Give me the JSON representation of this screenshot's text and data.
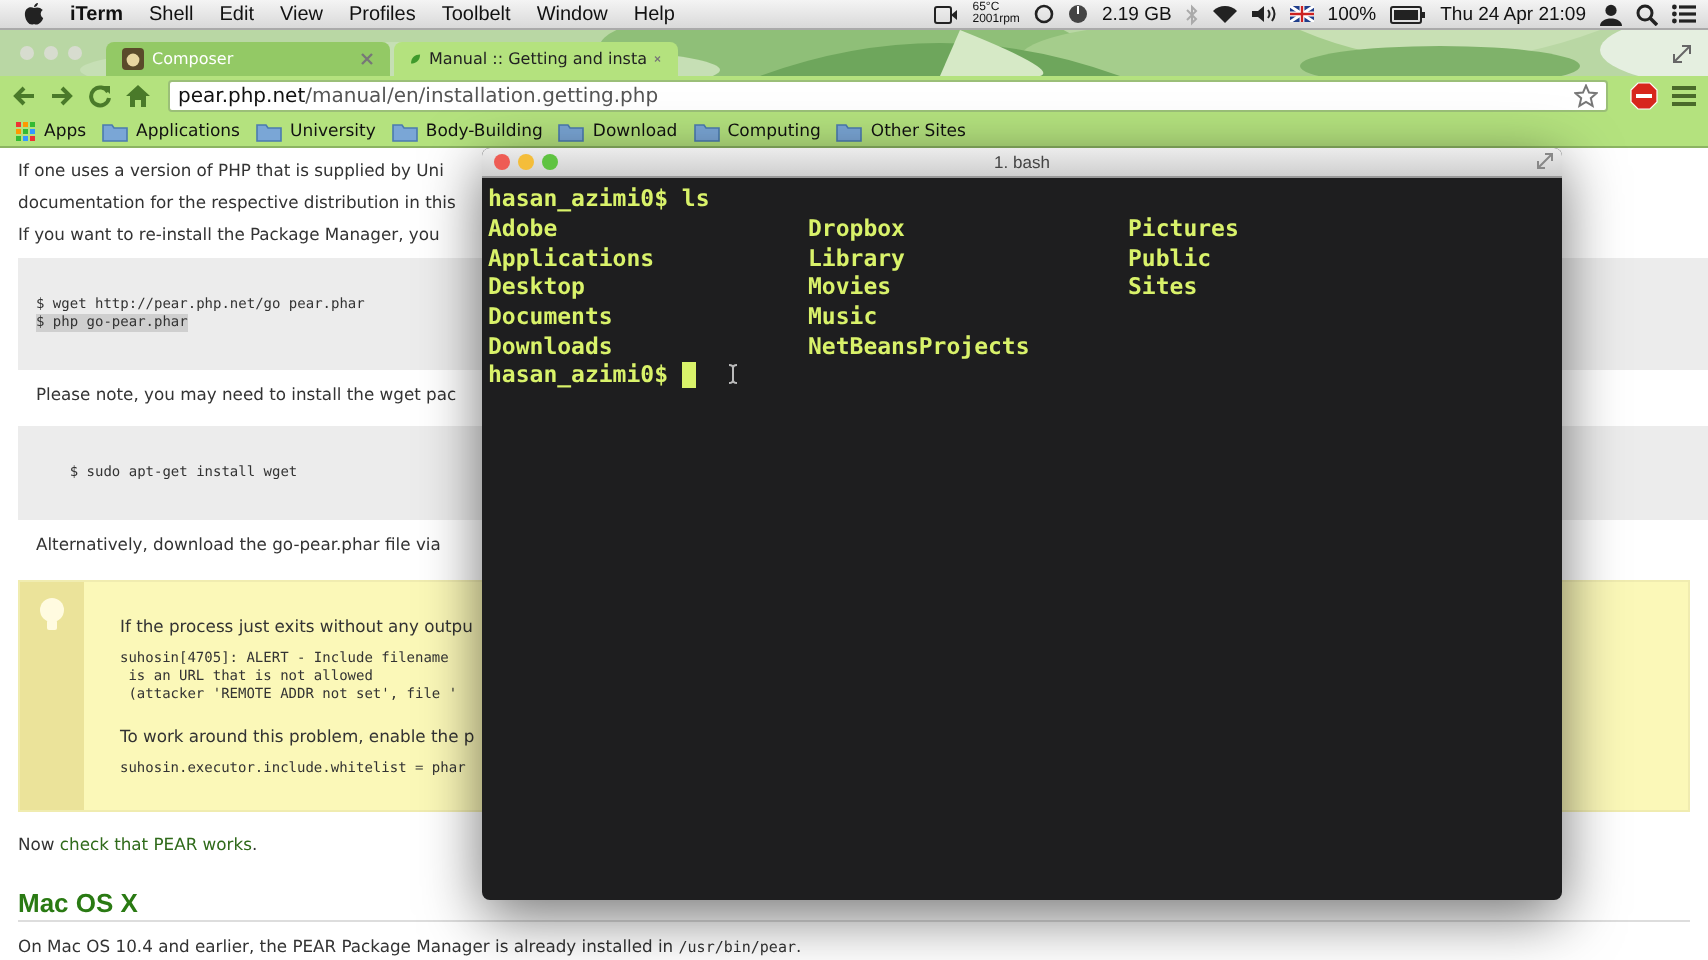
{
  "menubar": {
    "app": "iTerm",
    "menus": [
      "Shell",
      "Edit",
      "View",
      "Profiles",
      "Toolbelt",
      "Window",
      "Help"
    ],
    "status": {
      "temperature": "65°C",
      "fan": "2001rpm",
      "memory": "2.19 GB",
      "battery": "100%",
      "clock": "Thu 24 Apr  21:09"
    }
  },
  "browser": {
    "tabs": [
      {
        "label": "Composer",
        "selected": false
      },
      {
        "label": "Manual :: Getting and insta",
        "selected": true
      }
    ],
    "url": {
      "host": "pear.php.net",
      "path": "/manual/en/installation.getting.php"
    },
    "bookmarks": [
      {
        "label": "Apps",
        "kind": "apps"
      },
      {
        "label": "Applications",
        "kind": "folder"
      },
      {
        "label": "University",
        "kind": "folder"
      },
      {
        "label": "Body-Building",
        "kind": "folder"
      },
      {
        "label": "Download",
        "kind": "folder"
      },
      {
        "label": "Computing",
        "kind": "folder"
      },
      {
        "label": "Other Sites",
        "kind": "folder"
      }
    ]
  },
  "page": {
    "blocks": [
      {
        "kind": "para",
        "lines": [
          "If one uses a version of PHP that is supplied by Uni",
          "documentation for the respective distribution in this"
        ]
      },
      {
        "kind": "para",
        "lines": [
          "If you want to re-install the Package Manager, you"
        ]
      },
      {
        "kind": "code",
        "lines": [
          {
            "text": "$ wget http://pear.php.net/go pear.phar",
            "highlighted": false
          },
          {
            "text": "$ php go-pear.phar",
            "highlighted": true
          }
        ]
      },
      {
        "kind": "indent",
        "lines": [
          "Please note, you may need to install the wget pac"
        ]
      },
      {
        "kind": "code",
        "lines": [
          {
            "text": "    $ sudo apt-get install wget",
            "highlighted": false
          }
        ]
      },
      {
        "kind": "indent",
        "lines": [
          "Alternatively, download the go-pear.phar file via"
        ]
      },
      {
        "kind": "note",
        "blocks": [
          {
            "kind": "para",
            "lines": [
              "If the process just exits without any outpu"
            ]
          },
          {
            "kind": "code",
            "lines": [
              {
                "text": "suhosin[4705]: ALERT - Include filename",
                "highlighted": false
              },
              {
                "text": " is an URL that is not allowed",
                "highlighted": false
              },
              {
                "text": " (attacker 'REMOTE ADDR not set', file '",
                "highlighted": false
              }
            ]
          },
          {
            "kind": "para",
            "lines": [
              "To work around this problem, enable the p"
            ]
          },
          {
            "kind": "code",
            "lines": [
              {
                "text": "suhosin.executor.include.whitelist = phar",
                "highlighted": false
              }
            ]
          }
        ]
      },
      {
        "kind": "mixed",
        "parts": [
          {
            "text": "Now "
          },
          {
            "text": "check that PEAR works",
            "link": true
          },
          {
            "text": "."
          }
        ]
      },
      {
        "kind": "heading",
        "lines": [
          "Mac OS X"
        ]
      },
      {
        "kind": "mixed",
        "parts": [
          {
            "text": "On Mac OS 10.4 and earlier, the PEAR Package Manager is already installed in "
          },
          {
            "text": "/usr/bin/pear",
            "code": true
          },
          {
            "text": "."
          }
        ]
      }
    ]
  },
  "terminal": {
    "title": "1. bash",
    "lines": [
      {
        "kind": "prompt",
        "prompt": "hasan_azimi0$",
        "command": "ls",
        "cursor": false
      },
      {
        "kind": "listing",
        "cells": [
          "Adobe",
          "Dropbox",
          "Pictures"
        ]
      },
      {
        "kind": "listing",
        "cells": [
          "Applications",
          "Library",
          "Public"
        ]
      },
      {
        "kind": "listing",
        "cells": [
          "Desktop",
          "Movies",
          "Sites"
        ]
      },
      {
        "kind": "listing",
        "cells": [
          "Documents",
          "Music"
        ]
      },
      {
        "kind": "listing",
        "cells": [
          "Downloads",
          "NetBeansProjects"
        ]
      },
      {
        "kind": "prompt",
        "prompt": "hasan_azimi0$",
        "cursor": true
      }
    ]
  }
}
